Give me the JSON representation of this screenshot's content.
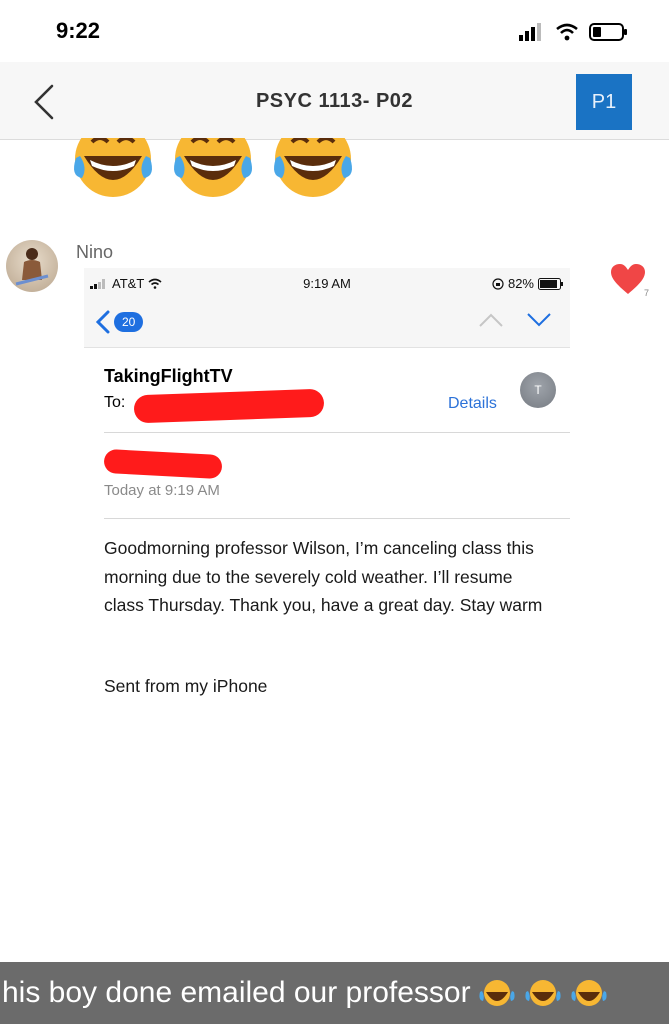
{
  "status_bar": {
    "time": "9:22"
  },
  "header": {
    "title": "PSYC 1113- P02",
    "page_label": "P1"
  },
  "reaction_emojis": [
    "tears-of-joy-emoji",
    "tears-of-joy-emoji",
    "tears-of-joy-emoji"
  ],
  "post": {
    "author": "Nino",
    "like_count": "7",
    "screenshot": {
      "status": {
        "carrier": "AT&T",
        "time": "9:19 AM",
        "battery": "82%"
      },
      "nav": {
        "message_count": "20"
      },
      "sender": "TakingFlightTV",
      "to_label": "To:",
      "details_label": "Details",
      "avatar_initial": "T",
      "date": "Today at 9:19 AM",
      "body": "Goodmorning professor Wilson, I’m canceling class this morning due to the severely cold weather. I’ll resume class Thursday. Thank you, have a great day. Stay warm",
      "signature": "Sent from my iPhone"
    }
  },
  "caption": {
    "text": "his boy done emailed our professor"
  },
  "colors": {
    "accent": "#1a73c4",
    "heart": "#f04646",
    "redaction": "#ff1b1b",
    "link": "#2c72d8",
    "caption_bg": "#6b6b6b"
  }
}
